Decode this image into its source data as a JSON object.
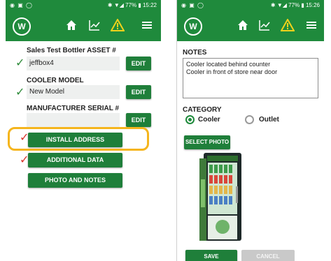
{
  "left_phone": {
    "status": {
      "left_icons": "◉ ▣ ◯",
      "right_text": "✱ ▼◢ 77% ▮ 15:22"
    },
    "asset_label": "Sales Test Bottler ASSET #",
    "asset_value": "jeffbox4",
    "cooler_label": "COOLER MODEL",
    "cooler_value": "New Model",
    "serial_label": "MANUFACTURER SERIAL #",
    "serial_value": "",
    "edit_label": "EDIT",
    "install_address": "INSTALL ADDRESS",
    "additional_data": "ADDITIONAL DATA",
    "photo_and_notes": "PHOTO AND NOTES"
  },
  "right_phone": {
    "status": {
      "left_icons": "◉ ▣ ◯",
      "right_text": "✱ ▼◢ 77% ▮ 15:26"
    },
    "notes_label": "NOTES",
    "notes_lines": [
      "Cooler located behind counter",
      "Cooler in front of store near door"
    ],
    "category_label": "CATEGORY",
    "category_options": [
      "Cooler",
      "Outlet"
    ],
    "selected_category": "Cooler",
    "select_photo": "SELECT PHOTO",
    "save": "SAVE",
    "cancel": "CANCEL"
  },
  "icons": {
    "logo": "W",
    "home": "home-icon",
    "chart": "chart-icon",
    "warning": "warning-icon",
    "menu": "menu-icon"
  },
  "colors": {
    "brand_green": "#1f8a3c",
    "button_green": "#1f7f3a",
    "highlight": "#f5b51d",
    "warning": "#f2d21b",
    "check_green": "#2e8b3a",
    "check_red": "#d9342b",
    "disabled": "#c9c9c9"
  }
}
